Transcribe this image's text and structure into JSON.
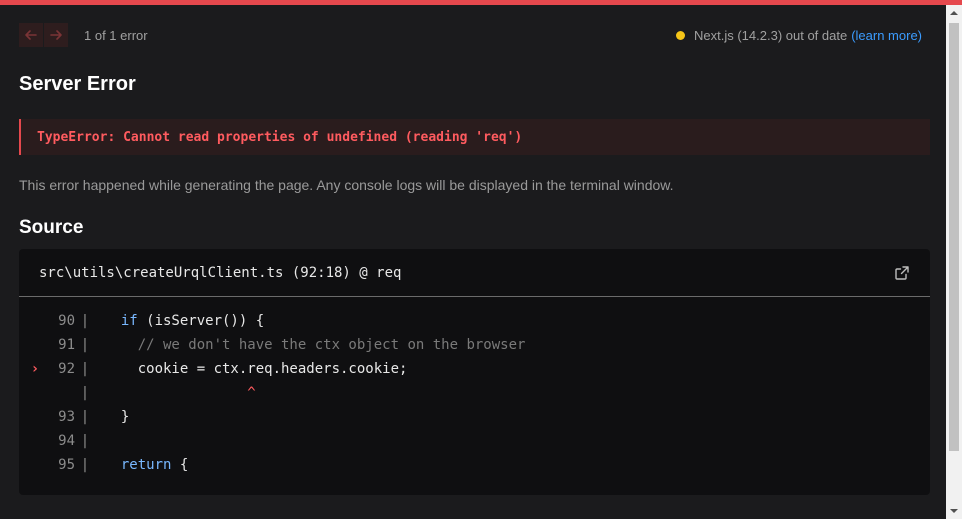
{
  "nav": {
    "prev_icon": "arrow-left-icon",
    "next_icon": "arrow-right-icon",
    "error_count": "1 of 1 error"
  },
  "version": {
    "status_color": "#f5c518",
    "text": "Next.js (14.2.3) out of date",
    "link": "(learn more)"
  },
  "title": "Server Error",
  "error_message": "TypeError: Cannot read properties of undefined (reading 'req')",
  "description": "This error happened while generating the page. Any console logs will be displayed in the terminal window.",
  "source": {
    "heading": "Source",
    "file": "src\\utils\\createUrqlClient.ts (92:18) @ req",
    "open_icon": "external-link-icon",
    "lines": [
      {
        "marker": "",
        "num": "90",
        "parts": [
          {
            "t": "  ",
            "c": ""
          },
          {
            "t": "if",
            "c": "kw"
          },
          {
            "t": " (isServer()) {",
            "c": ""
          }
        ]
      },
      {
        "marker": "",
        "num": "91",
        "parts": [
          {
            "t": "    ",
            "c": ""
          },
          {
            "t": "// we don't have the ctx object on the browser",
            "c": "cm"
          }
        ]
      },
      {
        "marker": "›",
        "num": "92",
        "parts": [
          {
            "t": "    cookie = ctx.req.headers.cookie;",
            "c": ""
          }
        ]
      },
      {
        "marker": "",
        "num": "",
        "parts": [
          {
            "t": "                 ",
            "c": ""
          },
          {
            "t": "^",
            "c": "caret"
          }
        ]
      },
      {
        "marker": "",
        "num": "93",
        "parts": [
          {
            "t": "  }",
            "c": ""
          }
        ]
      },
      {
        "marker": "",
        "num": "94",
        "parts": []
      },
      {
        "marker": "",
        "num": "95",
        "parts": [
          {
            "t": "  ",
            "c": ""
          },
          {
            "t": "return",
            "c": "kw"
          },
          {
            "t": " {",
            "c": ""
          }
        ]
      }
    ]
  },
  "colors": {
    "accent": "#e5484d",
    "error_text": "#ff5b5f",
    "link": "#3b9cff",
    "keyword": "#79b8ff"
  }
}
